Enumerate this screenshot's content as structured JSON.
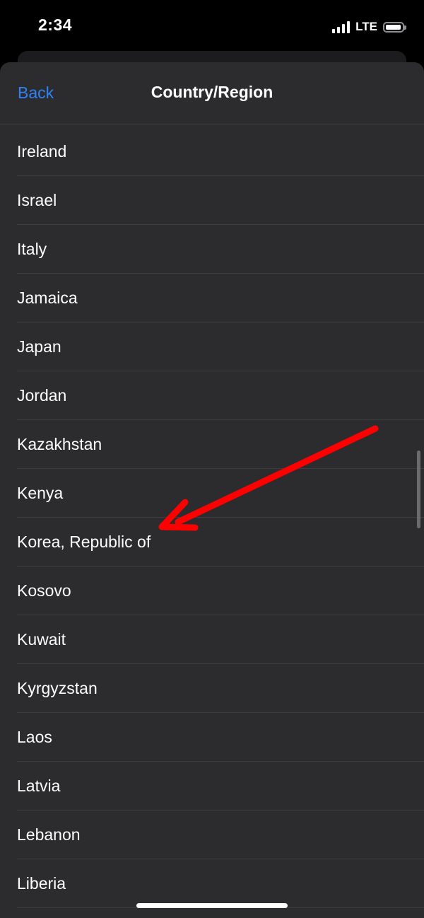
{
  "status_bar": {
    "time": "2:34",
    "network": "LTE"
  },
  "nav": {
    "back_label": "Back",
    "title": "Country/Region"
  },
  "countries": [
    "Ireland",
    "Israel",
    "Italy",
    "Jamaica",
    "Japan",
    "Jordan",
    "Kazakhstan",
    "Kenya",
    "Korea, Republic of",
    "Kosovo",
    "Kuwait",
    "Kyrgyzstan",
    "Laos",
    "Latvia",
    "Lebanon",
    "Liberia"
  ],
  "colors": {
    "accent": "#2f82f6",
    "sheet_background": "#2c2c2e",
    "annotation_arrow": "#ff0000"
  }
}
